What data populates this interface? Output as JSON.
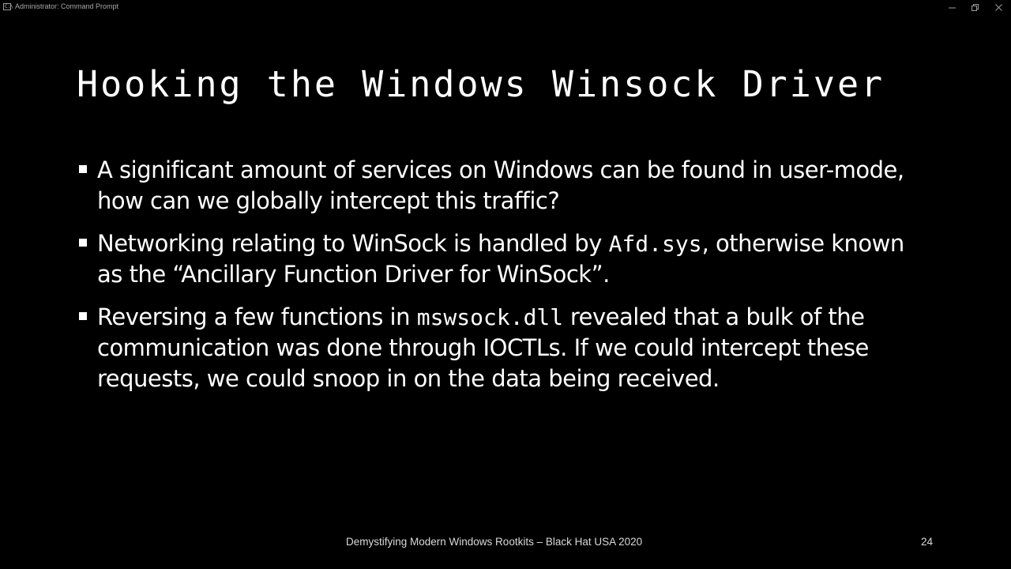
{
  "window": {
    "title": "Administrator: Command Prompt",
    "icon_text": "C:\\"
  },
  "slide": {
    "title": "Hooking the Windows Winsock Driver",
    "bullets": [
      {
        "parts": [
          {
            "text": "A significant amount of services on Windows can be found in user-mode, how can we globally intercept this traffic?",
            "code": false
          }
        ]
      },
      {
        "parts": [
          {
            "text": "Networking relating to WinSock is handled by ",
            "code": false
          },
          {
            "text": "Afd.sys",
            "code": true
          },
          {
            "text": ", otherwise known as the “Ancillary Function Driver for WinSock”.",
            "code": false
          }
        ]
      },
      {
        "parts": [
          {
            "text": "Reversing a few functions in ",
            "code": false
          },
          {
            "text": "mswsock.dll",
            "code": true
          },
          {
            "text": " revealed that a bulk of the communication was done through IOCTLs. If we could intercept these requests, we could snoop in on the data being received.",
            "code": false
          }
        ]
      }
    ],
    "footer": "Demystifying Modern Windows Rootkits – Black Hat USA 2020",
    "page_number": "24"
  }
}
